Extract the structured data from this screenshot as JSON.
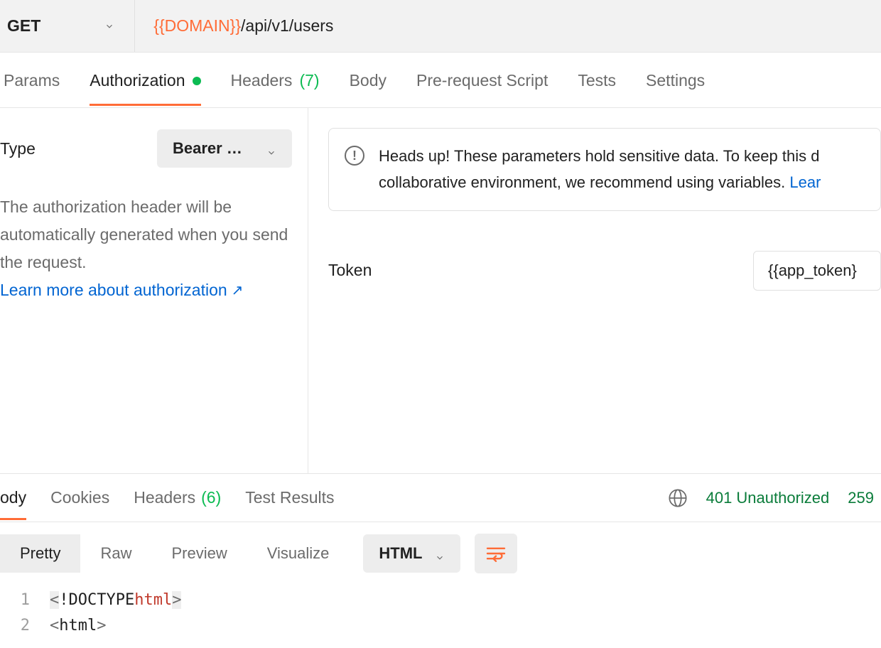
{
  "request": {
    "method": "GET",
    "url_variable": "{{DOMAIN}}",
    "url_path": "/api/v1/users"
  },
  "request_tabs": {
    "params": "Params",
    "authorization": "Authorization",
    "headers_label": "Headers",
    "headers_count": "(7)",
    "body": "Body",
    "pre_request": "Pre-request Script",
    "tests": "Tests",
    "settings": "Settings"
  },
  "auth": {
    "type_label": "Type",
    "type_value": "Bearer …",
    "description": "The authorization header will be automatically generated when you send the request.",
    "learn_more": "Learn more about authorization",
    "notice_text_1": "Heads up! These parameters hold sensitive data. To keep this d",
    "notice_text_2": "collaborative environment, we recommend using variables. ",
    "notice_link": "Lear",
    "token_label": "Token",
    "token_value": "{{app_token}"
  },
  "response_tabs": {
    "body": "ody",
    "cookies": "Cookies",
    "headers_label": "Headers",
    "headers_count": "(6)",
    "test_results": "Test Results"
  },
  "status": {
    "code_text": "401 Unauthorized",
    "time_text": "259"
  },
  "view": {
    "pretty": "Pretty",
    "raw": "Raw",
    "preview": "Preview",
    "visualize": "Visualize",
    "format": "HTML"
  },
  "code": {
    "line1_no": "1",
    "line1_a": "<",
    "line1_b": "!DOCTYPE ",
    "line1_c": "html",
    "line1_d": ">",
    "line2_no": "2",
    "line2_a": "<",
    "line2_b": "html",
    "line2_c": ">"
  }
}
